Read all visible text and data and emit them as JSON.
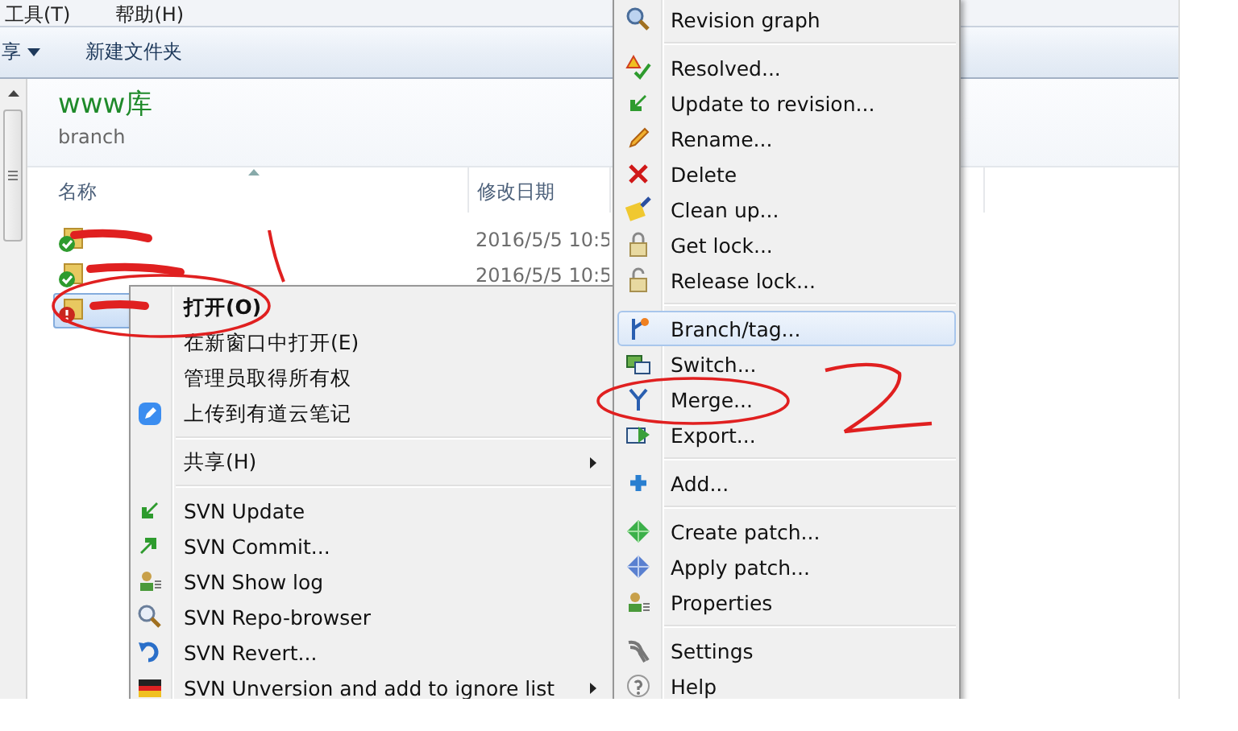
{
  "menu_bar": [
    {
      "label": "工具(T)"
    },
    {
      "label": "帮助(H)"
    }
  ],
  "toolbar": [
    {
      "label": "享",
      "dropdown": true
    },
    {
      "label": "新建文件夹",
      "dropdown": false
    }
  ],
  "folder": {
    "title": "www库",
    "subtitle": "branch"
  },
  "columns": [
    {
      "label": "名称",
      "sorted": true
    },
    {
      "label": "修改日期",
      "sorted": false
    }
  ],
  "rows": [
    {
      "kind": "ok",
      "date": "2016/5/5 10:5",
      "selected": false
    },
    {
      "kind": "ok",
      "date": "2016/5/5 10:5",
      "selected": false
    },
    {
      "kind": "conflict",
      "selected": true
    }
  ],
  "context_menu": {
    "items": [
      {
        "kind": "item",
        "label": "打开(O)",
        "bold": true,
        "selected": false
      },
      {
        "kind": "item",
        "label": "在新窗口中打开(E)",
        "bold": false,
        "selected": false
      },
      {
        "kind": "item",
        "label": "管理员取得所有权",
        "bold": false,
        "selected": false
      },
      {
        "kind": "item",
        "label": "上传到有道云笔记",
        "bold": false,
        "selected": false
      },
      {
        "kind": "separator"
      },
      {
        "kind": "submenu",
        "label": "共享(H)",
        "bold": false,
        "selected": false
      },
      {
        "kind": "separator"
      },
      {
        "kind": "item",
        "label": "SVN Update",
        "bold": false,
        "selected": false
      },
      {
        "kind": "item",
        "label": "SVN Commit...",
        "bold": false,
        "selected": false
      },
      {
        "kind": "item",
        "label": "SVN Show log",
        "bold": false,
        "selected": false
      },
      {
        "kind": "item",
        "label": "SVN Repo-browser",
        "bold": false,
        "selected": false
      },
      {
        "kind": "item",
        "label": "SVN Revert...",
        "bold": false,
        "selected": false
      },
      {
        "kind": "submenu",
        "label": "SVN Unversion and add to ignore list",
        "bold": false,
        "selected": false
      }
    ]
  },
  "svn_submenu": {
    "items": [
      {
        "kind": "item",
        "label": "Revision graph",
        "selected": false
      },
      {
        "kind": "separator"
      },
      {
        "kind": "item",
        "label": "Resolved...",
        "selected": false
      },
      {
        "kind": "item",
        "label": "Update to revision...",
        "selected": false
      },
      {
        "kind": "item",
        "label": "Rename...",
        "selected": false
      },
      {
        "kind": "item",
        "label": "Delete",
        "selected": false
      },
      {
        "kind": "item",
        "label": "Clean up...",
        "selected": false
      },
      {
        "kind": "item",
        "label": "Get lock...",
        "selected": false
      },
      {
        "kind": "item",
        "label": "Release lock...",
        "selected": false
      },
      {
        "kind": "separator"
      },
      {
        "kind": "item",
        "label": "Branch/tag...",
        "selected": true
      },
      {
        "kind": "item",
        "label": "Switch...",
        "selected": false
      },
      {
        "kind": "item",
        "label": "Merge...",
        "selected": false
      },
      {
        "kind": "item",
        "label": "Export...",
        "selected": false
      },
      {
        "kind": "separator"
      },
      {
        "kind": "item",
        "label": "Add...",
        "selected": false
      },
      {
        "kind": "separator"
      },
      {
        "kind": "item",
        "label": "Create patch...",
        "selected": false
      },
      {
        "kind": "item",
        "label": "Apply patch...",
        "selected": false
      },
      {
        "kind": "item",
        "label": "Properties",
        "selected": false
      },
      {
        "kind": "separator"
      },
      {
        "kind": "item",
        "label": "Settings",
        "selected": false
      },
      {
        "kind": "item",
        "label": "Help",
        "selected": false
      }
    ]
  }
}
